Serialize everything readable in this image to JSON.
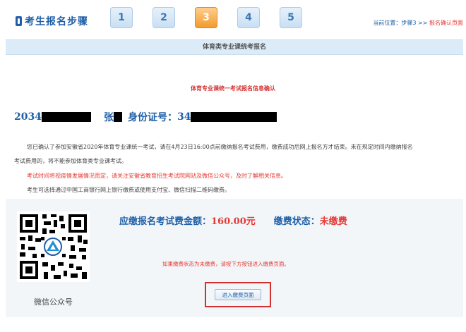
{
  "header": {
    "title": "考生报名步骤",
    "steps": [
      "1",
      "2",
      "3",
      "4",
      "5"
    ],
    "active_step": 3,
    "location_prefix": "当前位置：步骤3 >> ",
    "location_current": "报名确认页面"
  },
  "title_bar": "体育类专业课统考报名",
  "confirm_title": "体育专业课统一考试报名信息确认",
  "identity": {
    "reg_no_prefix": "2034",
    "name_prefix": "张",
    "id_label": "身份证号：",
    "id_prefix": "34"
  },
  "notices": {
    "line1": "您已确认了参加安徽省2020年体育专业课统一考试，请在4月23日16:00点前缴纳报名考试费用，缴费成功后网上报名方才结束。未在规定时间内缴纳报名",
    "line1_cont": "考试费用的，将不能参加体育类专业课考试。",
    "line2": "考试时间将视疫情发展情况而定，请关注安徽省教育招生考试院网站及微信公众号，及时了解相关信息。",
    "line3": "考生可选择通过中国工商银行网上银行缴费或使用支付宝、微信扫描二维码缴费。"
  },
  "payment": {
    "fee_label": "应缴报名考试费金额：",
    "fee_value": "160.00元",
    "status_label": "缴费状态：",
    "status_value": "未缴费",
    "hint": "如果缴费状态为未缴费，请按下方按钮进入缴费页面。",
    "button_label": "进入缴费页面",
    "qr_caption": "微信公众号"
  },
  "colors": {
    "accent": "#1f5fa7",
    "alert": "#e53935",
    "active_step": "#f39a2e"
  }
}
